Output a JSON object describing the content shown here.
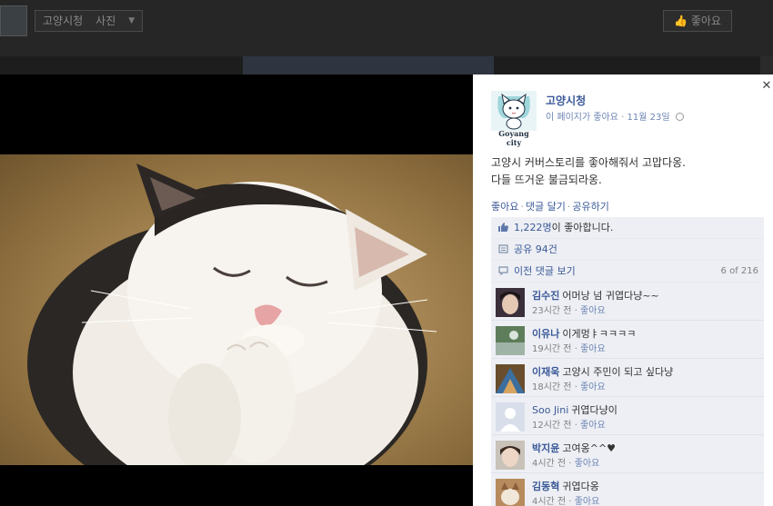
{
  "page_header": {
    "title": "고양시청",
    "section": "사진",
    "like_button": "좋아요"
  },
  "post": {
    "author": "고양시청",
    "profile_caption": "Goyang city",
    "meta_like": "이 페이지가 좋아요",
    "date": "11월 23일",
    "message_line1": "고양시 커버스토리를 좋아해줘서 고맙다옹.",
    "message_line2": "다들 뜨거운 불금되라옹.",
    "actions": [
      "좋아요",
      "댓글 달기",
      "공유하기"
    ]
  },
  "ufi": {
    "likes_count": "1,222명",
    "likes_suffix": "이 좋아합니다.",
    "shares": "공유 94건",
    "prev_comments": "이전 댓글 보기",
    "counter": "6 of 216"
  },
  "comments": [
    {
      "name": "김수진",
      "text": "어머낭 넘 귀엽다냥~~",
      "time": "23시간 전",
      "like": "좋아요"
    },
    {
      "name": "이유나",
      "text": "이게멍ㅑㅋㅋㅋㅋ",
      "time": "19시간 전",
      "like": "좋아요"
    },
    {
      "name": "이재욱",
      "text": "고양시 주민이 되고 싶다냥",
      "time": "18시간 전",
      "like": "좋아요"
    },
    {
      "name": "Soo Jini",
      "text": "귀엽다냥이",
      "time": "12시간 전",
      "like": "좋아요"
    },
    {
      "name": "박지윤",
      "text": "고여옹^^♥",
      "time": "4시간 전",
      "like": "좋아요"
    },
    {
      "name": "김동혁",
      "text": "귀엽다옹",
      "time": "4시간 전",
      "like": "좋아요"
    }
  ],
  "colors": {
    "link": "#3b5998",
    "ufi_bg": "#edeff4",
    "overlay_bg": "#1d1d1d"
  },
  "icons": [
    "thumbs-up-icon",
    "share-icon",
    "comment-bubble-icon",
    "globe-icon",
    "close-icon",
    "chevron-down-icon"
  ]
}
